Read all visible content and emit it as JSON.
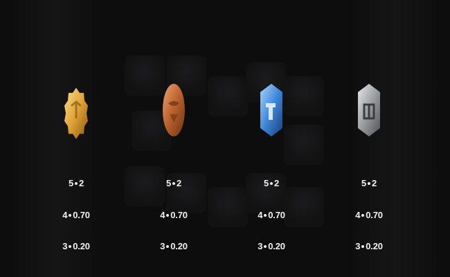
{
  "paytable": {
    "columns": [
      {
        "symbol_icon": "gold-cog-coin-icon",
        "color": "#d89a2a",
        "rows": [
          {
            "count": "5",
            "value": "2"
          },
          {
            "count": "4",
            "value": "0.70"
          },
          {
            "count": "3",
            "value": "0.20"
          }
        ]
      },
      {
        "symbol_icon": "copper-cog-coin-icon",
        "color": "#b8622e",
        "rows": [
          {
            "count": "5",
            "value": "2"
          },
          {
            "count": "4",
            "value": "0.70"
          },
          {
            "count": "3",
            "value": "0.20"
          }
        ]
      },
      {
        "symbol_icon": "blue-hammer-hex-icon",
        "color": "#3f86d8",
        "rows": [
          {
            "count": "5",
            "value": "2"
          },
          {
            "count": "4",
            "value": "0.70"
          },
          {
            "count": "3",
            "value": "0.20"
          }
        ]
      },
      {
        "symbol_icon": "silver-hex-coin-icon",
        "color": "#9a9d9f",
        "rows": [
          {
            "count": "5",
            "value": "2"
          },
          {
            "count": "4",
            "value": "0.70"
          },
          {
            "count": "3",
            "value": "0.20"
          }
        ]
      }
    ]
  }
}
